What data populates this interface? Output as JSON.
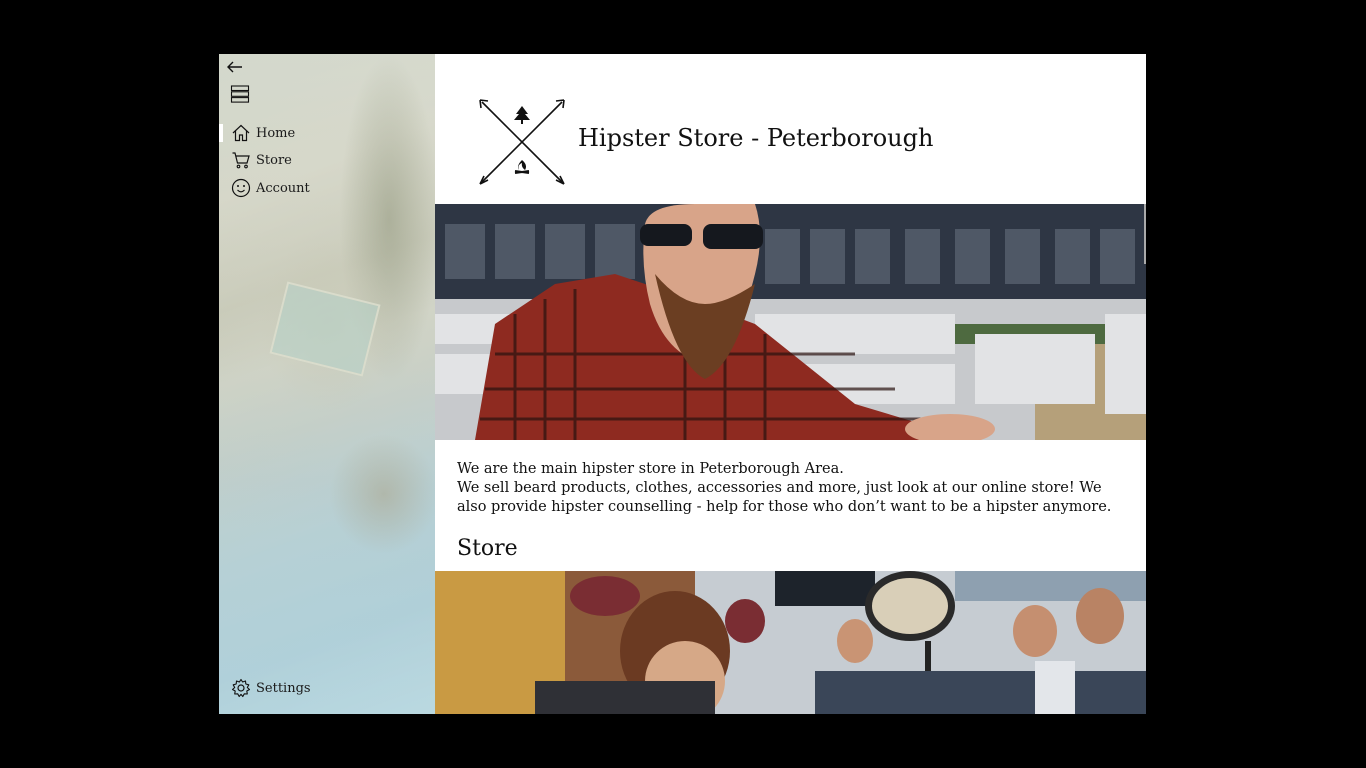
{
  "sidebar": {
    "back_icon": "arrow-left-icon",
    "menu_icon": "hamburger-menu-icon",
    "items": [
      {
        "label": "Home",
        "icon": "home-icon",
        "selected": true
      },
      {
        "label": "Store",
        "icon": "shopping-cart-icon",
        "selected": false
      },
      {
        "label": "Account",
        "icon": "smiley-face-icon",
        "selected": false
      }
    ],
    "settings": {
      "label": "Settings",
      "icon": "gear-icon"
    }
  },
  "header": {
    "logo": "crossed-arrows-tree-fire-logo",
    "title": "Hipster Store - Peterborough"
  },
  "main": {
    "hero_image": "bearded-man-sunglasses-plaid-shirt-photo",
    "intro_line_1": "We are the main hipster store in Peterborough Area.",
    "intro_line_2": "We sell beard products, clothes, accessories and more, just look at our online store! We also provide hipster counselling - help for those who don’t want to be a hipster anymore.",
    "store_heading": "Store",
    "store_image": "crowd-of-people-photo"
  },
  "colors": {
    "window_background": "#000000",
    "content_background": "#ffffff",
    "text": "#111111",
    "selection_indicator": "#ffffff"
  }
}
